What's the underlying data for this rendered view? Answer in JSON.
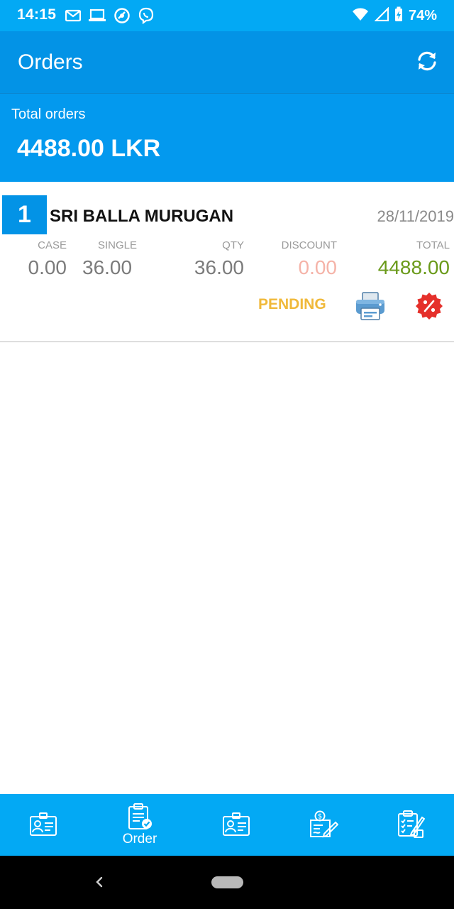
{
  "status_bar": {
    "time": "14:15",
    "battery": "74%",
    "icons": [
      "gmail-icon",
      "laptop-icon",
      "signal-app-icon",
      "viber-icon",
      "wifi-icon",
      "cell-signal-icon",
      "battery-charging-icon"
    ]
  },
  "app_bar": {
    "title": "Orders",
    "refresh_icon": "refresh-icon"
  },
  "summary": {
    "label": "Total orders",
    "value": "4488.00 LKR"
  },
  "orders": [
    {
      "index": "1",
      "customer": "SRI BALLA MURUGAN",
      "date": "28/11/2019",
      "columns": {
        "case_label": "CASE",
        "single_label": "SINGLE",
        "qty_label": "QTY",
        "discount_label": "DISCOUNT",
        "total_label": "TOTAL"
      },
      "case": "0.00",
      "single": "36.00",
      "qty": "36.00",
      "discount": "0.00",
      "total": "4488.00",
      "status": "PENDING",
      "actions": [
        "printer-icon",
        "discount-badge-icon"
      ]
    }
  ],
  "bottom_nav": {
    "items": [
      {
        "icon": "id-card-icon",
        "label": ""
      },
      {
        "icon": "order-clipboard-icon",
        "label": "Order"
      },
      {
        "icon": "id-card-icon",
        "label": ""
      },
      {
        "icon": "payment-check-icon",
        "label": ""
      },
      {
        "icon": "checklist-icon",
        "label": ""
      }
    ]
  },
  "colors": {
    "status_bar": "#03a9f4",
    "app_bar": "#0393e6",
    "summary_panel": "#0399ee",
    "pending": "#f0b93a",
    "total_green": "#6a9a1a",
    "discount_pink": "#f5b3a8",
    "discount_badge": "#e5302b"
  }
}
